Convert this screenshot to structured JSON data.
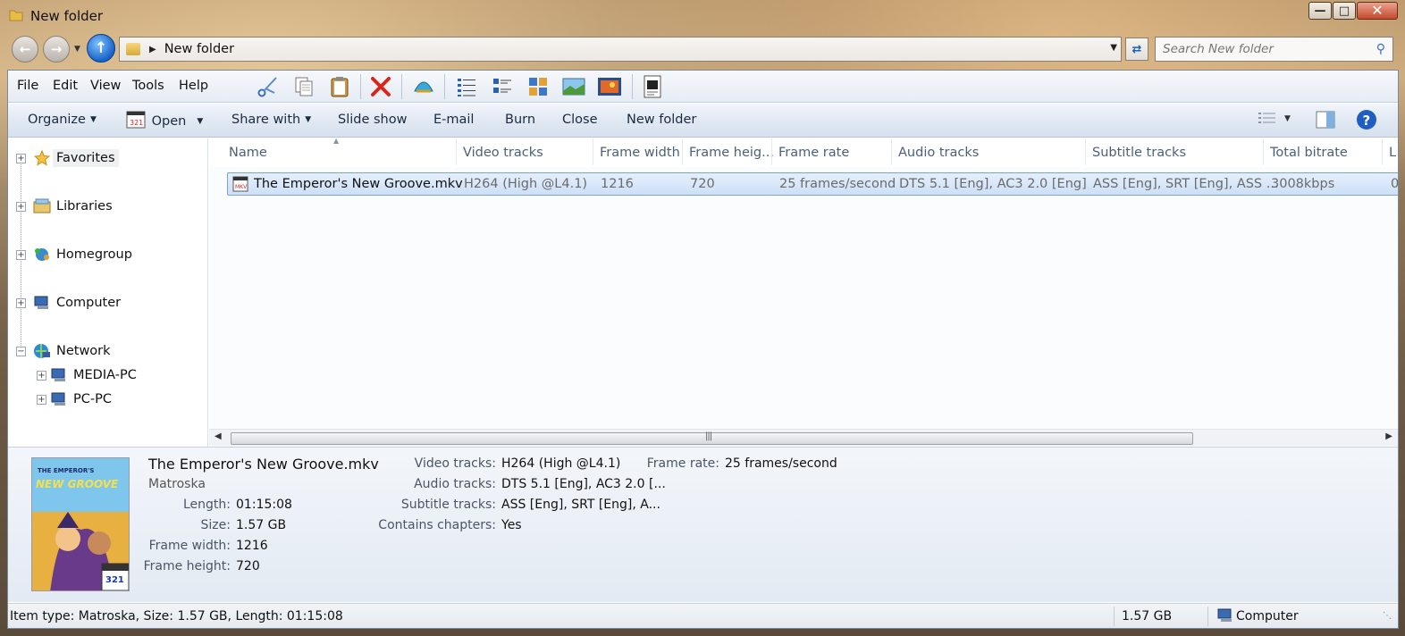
{
  "window": {
    "title": "New folder"
  },
  "address": {
    "path": "New folder",
    "search_placeholder": "Search New folder"
  },
  "menu": [
    "File",
    "Edit",
    "View",
    "Tools",
    "Help"
  ],
  "commands": {
    "organize": "Organize",
    "open": "Open",
    "share_with": "Share with",
    "slide_show": "Slide show",
    "email": "E-mail",
    "burn": "Burn",
    "close": "Close",
    "new_folder": "New folder"
  },
  "nav": {
    "favorites": "Favorites",
    "libraries": "Libraries",
    "homegroup": "Homegroup",
    "computer": "Computer",
    "network": "Network",
    "network_children": [
      "MEDIA-PC",
      "PC-PC"
    ]
  },
  "columns": [
    "Name",
    "Video tracks",
    "Frame width",
    "Frame heig...",
    "Frame rate",
    "Audio tracks",
    "Subtitle tracks",
    "Total bitrate",
    "L"
  ],
  "file": {
    "name": "The Emperor's New Groove.mkv",
    "video_tracks": "H264 (High @L4.1)",
    "frame_width": "1216",
    "frame_height": "720",
    "frame_rate": "25 frames/second",
    "audio_tracks": "DTS 5.1 [Eng], AC3 2.0 [Eng]",
    "subtitle_tracks": "ASS [Eng], SRT [Eng], ASS ...",
    "total_bitrate": "3008kbps",
    "extra": "0"
  },
  "details": {
    "title": "The Emperor's New Groove.mkv",
    "type": "Matroska",
    "cover_badge": "321",
    "cover_logo_top": "THE EMPEROR'S",
    "cover_logo_bottom": "NEW GROOVE",
    "length_label": "Length:",
    "length": "01:15:08",
    "size_label": "Size:",
    "size": "1.57 GB",
    "fw_label": "Frame width:",
    "fw": "1216",
    "fh_label": "Frame height:",
    "fh": "720",
    "vt_label": "Video tracks:",
    "vt": "H264 (High @L4.1)",
    "at_label": "Audio tracks:",
    "at": "DTS 5.1 [Eng], AC3 2.0 [...",
    "st_label": "Subtitle tracks:",
    "st": "ASS [Eng], SRT [Eng], A...",
    "ch_label": "Contains chapters:",
    "ch": "Yes",
    "fr_label": "Frame rate:",
    "fr": "25 frames/second"
  },
  "status": {
    "info": "Item type: Matroska, Size: 1.57 GB, Length: 01:15:08",
    "size": "1.57 GB",
    "location": "Computer"
  },
  "icons": {
    "accent_blue": "#1763c9",
    "selection": "#cde0f7"
  }
}
